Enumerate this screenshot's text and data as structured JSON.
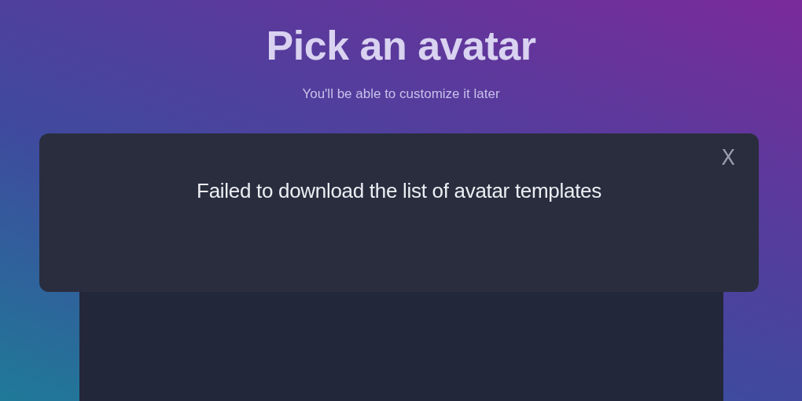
{
  "header": {
    "title": "Pick an avatar",
    "subtitle": "You'll be able to customize it later"
  },
  "dialog": {
    "message": "Failed to download the list of avatar templates",
    "close": "X"
  }
}
